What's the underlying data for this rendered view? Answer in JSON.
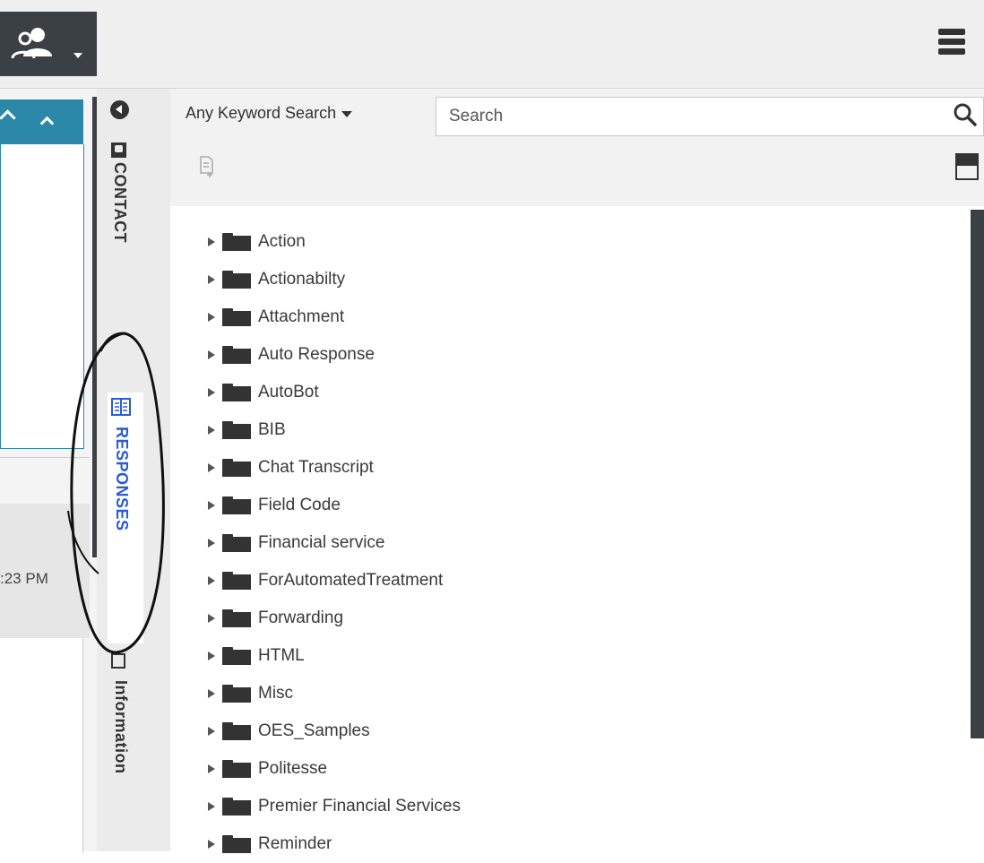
{
  "header": {
    "agent_icon": "agent-status-icon",
    "menu_icon": "hamburger-icon"
  },
  "left_panel": {
    "timestamp": ":23 PM"
  },
  "side_tabs": [
    {
      "label": "CONTACT",
      "icon": "contact-card-icon"
    },
    {
      "label": "RESPONSES",
      "icon": "book-icon",
      "active": true
    },
    {
      "label": "Information",
      "icon": "information-icon"
    }
  ],
  "responses": {
    "search_mode": "Any Keyword Search",
    "search_placeholder": "Search",
    "folders": [
      "Action",
      "Actionabilty",
      "Attachment",
      "Auto Response",
      "AutoBot",
      "BIB",
      "Chat Transcript",
      "Field Code",
      "Financial service",
      "ForAutomatedTreatment",
      "Forwarding",
      "HTML",
      "Misc",
      "OES_Samples",
      "Politesse",
      "Premier Financial Services",
      "Reminder"
    ]
  },
  "colors": {
    "accent": "#2c88a8",
    "active_tab_text": "#2a5bd7",
    "dark": "#3a4044"
  }
}
